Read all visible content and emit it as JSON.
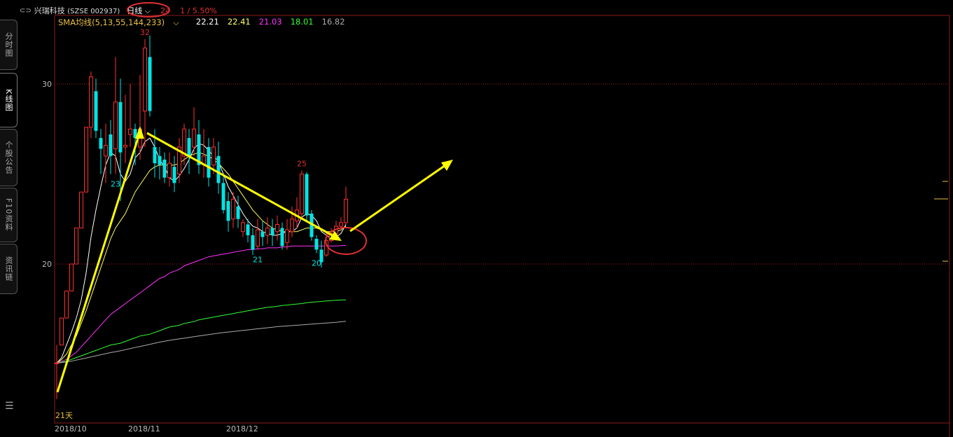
{
  "header": {
    "link_icon": "link-icon",
    "stock_name": "兴瑞科技",
    "stock_code": "(SZSE 002937)",
    "period": "日线",
    "chevron": "⌵",
    "last_label": "24",
    "page_info": "1 / 5.50%"
  },
  "sma": {
    "label": "SMA均线(5,13,55,144,233)",
    "chevron": "⌵",
    "v5": "22.21",
    "v13": "22.41",
    "v55": "21.03",
    "v144": "18.01",
    "v233": "16.82",
    "colors": {
      "v5": "#ffffff",
      "v13": "#ffff66",
      "v55": "#ff33ff",
      "v144": "#33ff33",
      "v233": "#aaaaaa"
    }
  },
  "sidebar": {
    "tabs": [
      {
        "label": "分时图"
      },
      {
        "label": "K线图"
      },
      {
        "label": "个股公告"
      },
      {
        "label": "F10资料"
      },
      {
        "label": "资讯链"
      }
    ],
    "menu_icon": "☰"
  },
  "chart_data": {
    "type": "candlestick",
    "y_ticks": [
      20,
      30
    ],
    "ylim": [
      14,
      33
    ],
    "x_labels": [
      {
        "label": "2018/10",
        "index": 0
      },
      {
        "label": "2018/11",
        "index": 15
      },
      {
        "label": "2018/12",
        "index": 35
      }
    ],
    "annotations": {
      "high": {
        "label": "32",
        "index": 18
      },
      "low1": {
        "label": "23",
        "index": 12
      },
      "high2": {
        "label": "25",
        "index": 50
      },
      "low2": {
        "label": "21",
        "index": 41
      },
      "low3": {
        "label": "20",
        "index": 53
      },
      "bottom": {
        "label": "21天"
      }
    },
    "up_color": "#ff3030",
    "down_color": "#00e5e5",
    "candles": [
      [
        14.5,
        14.5,
        15.5,
        12.5
      ],
      [
        15.5,
        17.0,
        17.0,
        15.5
      ],
      [
        17.0,
        18.5,
        18.5,
        17.0
      ],
      [
        18.5,
        20.0,
        20.0,
        18.5
      ],
      [
        20.0,
        22.0,
        22.0,
        20.0
      ],
      [
        22.0,
        24.0,
        24.0,
        22.0
      ],
      [
        24.0,
        27.6,
        27.6,
        24.0
      ],
      [
        27.6,
        30.4,
        30.7,
        27.0
      ],
      [
        29.6,
        27.4,
        30.3,
        27.0
      ],
      [
        27.0,
        26.4,
        27.5,
        25.0
      ],
      [
        26.0,
        26.6,
        27.8,
        24.5
      ],
      [
        27.2,
        26.0,
        28.0,
        25.0
      ],
      [
        26.4,
        29.0,
        31.5,
        25.0
      ],
      [
        29.0,
        26.2,
        30.3,
        23.5
      ],
      [
        26.5,
        26.6,
        29.4,
        25.6
      ],
      [
        27.2,
        27.5,
        30.0,
        26.5
      ],
      [
        27.5,
        27.0,
        27.8,
        25.5
      ],
      [
        26.5,
        27.5,
        30.5,
        25.8
      ],
      [
        28.5,
        32.0,
        32.5,
        26.5
      ],
      [
        31.5,
        28.5,
        32.7,
        28.2
      ],
      [
        26.5,
        25.6,
        27.5,
        24.8
      ],
      [
        26.0,
        25.5,
        26.5,
        24.7
      ],
      [
        25.8,
        24.8,
        26.2,
        24.5
      ],
      [
        24.8,
        25.6,
        26.2,
        24.3
      ],
      [
        25.4,
        24.5,
        26.0,
        24.0
      ],
      [
        25.0,
        26.5,
        27.0,
        24.5
      ],
      [
        26.0,
        27.5,
        27.8,
        25.5
      ],
      [
        27.0,
        26.0,
        27.5,
        25.0
      ],
      [
        26.5,
        27.5,
        28.7,
        26.0
      ],
      [
        27.2,
        25.5,
        28.0,
        25.0
      ],
      [
        25.5,
        26.0,
        27.5,
        24.8
      ],
      [
        26.5,
        24.8,
        27.0,
        24.3
      ],
      [
        25.5,
        26.5,
        27.0,
        25.0
      ],
      [
        26.0,
        24.5,
        26.8,
        23.9
      ],
      [
        24.5,
        23.0,
        25.0,
        22.8
      ],
      [
        23.5,
        22.4,
        24.0,
        21.8
      ],
      [
        22.5,
        23.6,
        24.0,
        22.0
      ],
      [
        23.2,
        22.5,
        23.8,
        22.0
      ],
      [
        21.8,
        22.3,
        22.5,
        21.5
      ],
      [
        22.2,
        21.6,
        22.5,
        21.2
      ],
      [
        21.6,
        20.8,
        22.0,
        20.5
      ],
      [
        21.0,
        21.9,
        22.5,
        20.8
      ],
      [
        21.8,
        21.5,
        22.4,
        21.0
      ],
      [
        21.6,
        22.0,
        22.6,
        21.1
      ],
      [
        22.0,
        21.6,
        22.5,
        21.0
      ],
      [
        21.8,
        22.2,
        22.7,
        21.3
      ],
      [
        22.0,
        21.0,
        22.3,
        20.8
      ],
      [
        21.2,
        21.9,
        22.5,
        20.8
      ],
      [
        21.8,
        22.5,
        23.2,
        21.5
      ],
      [
        22.4,
        23.0,
        23.7,
        22.0
      ],
      [
        22.8,
        25.0,
        25.2,
        22.5
      ],
      [
        25.0,
        22.7,
        25.1,
        22.4
      ],
      [
        22.8,
        21.5,
        23.0,
        21.3
      ],
      [
        21.4,
        20.8,
        21.6,
        20.6
      ],
      [
        20.8,
        20.1,
        21.3,
        19.8
      ],
      [
        20.5,
        21.3,
        21.8,
        20.4
      ],
      [
        21.3,
        21.7,
        22.0,
        21.2
      ],
      [
        21.7,
        22.1,
        22.4,
        21.6
      ],
      [
        22.1,
        22.3,
        22.6,
        22.0
      ],
      [
        22.3,
        23.6,
        24.3,
        22.2
      ]
    ],
    "sma_lines": [
      {
        "name": "SMA5",
        "color": "#ffffff",
        "values": [
          14.5,
          14.8,
          15.5,
          16.2,
          17.0,
          18.0,
          19.5,
          21.5,
          23.0,
          24.3,
          25.5,
          26.2,
          26.0,
          25.0,
          24.6,
          25.0,
          25.9,
          26.2,
          26.8,
          27.0,
          26.5,
          25.8,
          25.4,
          24.8,
          24.6,
          24.9,
          25.3,
          25.8,
          26.4,
          26.7,
          26.6,
          26.3,
          26.0,
          25.7,
          25.0,
          24.3,
          23.8,
          23.3,
          22.8,
          22.4,
          22.1,
          22.0,
          21.8,
          21.7,
          21.6,
          21.6,
          21.7,
          21.8,
          21.8,
          22.0,
          22.6,
          22.8,
          22.7,
          22.4,
          21.8,
          21.6,
          21.4,
          21.5,
          21.7,
          22.2
        ]
      },
      {
        "name": "SMA13",
        "color": "#ffff66",
        "values": [
          14.5,
          14.7,
          15.0,
          15.5,
          16.0,
          16.7,
          17.4,
          18.2,
          19.0,
          19.8,
          20.6,
          21.4,
          22.0,
          22.4,
          22.8,
          23.4,
          24.0,
          24.4,
          24.8,
          25.2,
          25.4,
          25.5,
          25.5,
          25.5,
          25.5,
          25.6,
          25.8,
          26.0,
          26.1,
          26.2,
          26.1,
          26.0,
          25.8,
          25.6,
          25.3,
          25.0,
          24.6,
          24.2,
          23.8,
          23.4,
          23.0,
          22.7,
          22.4,
          22.2,
          22.0,
          21.9,
          21.8,
          21.8,
          21.8,
          21.8,
          21.9,
          22.0,
          22.0,
          22.0,
          21.9,
          21.8,
          21.8,
          21.8,
          21.9,
          22.1
        ]
      },
      {
        "name": "SMA55",
        "color": "#ff33ff",
        "values": [
          14.5,
          14.6,
          14.7,
          14.9,
          15.1,
          15.4,
          15.7,
          16.0,
          16.3,
          16.6,
          16.9,
          17.2,
          17.4,
          17.6,
          17.8,
          18.0,
          18.2,
          18.4,
          18.6,
          18.8,
          19.0,
          19.2,
          19.3,
          19.5,
          19.6,
          19.7,
          19.9,
          20.0,
          20.1,
          20.2,
          20.3,
          20.4,
          20.45,
          20.5,
          20.55,
          20.6,
          20.65,
          20.7,
          20.75,
          20.8,
          20.8,
          20.85,
          20.85,
          20.9,
          20.9,
          20.9,
          20.95,
          20.95,
          21.0,
          21.0,
          21.0,
          21.0,
          21.0,
          21.0,
          21.0,
          21.0,
          21.0,
          21.0,
          21.02,
          21.03
        ]
      },
      {
        "name": "SMA144",
        "color": "#33ff33",
        "values": [
          14.5,
          14.55,
          14.6,
          14.7,
          14.8,
          14.9,
          15.0,
          15.1,
          15.2,
          15.3,
          15.4,
          15.5,
          15.55,
          15.6,
          15.7,
          15.8,
          15.9,
          16.0,
          16.05,
          16.1,
          16.2,
          16.3,
          16.4,
          16.5,
          16.55,
          16.6,
          16.7,
          16.75,
          16.8,
          16.9,
          16.95,
          17.0,
          17.05,
          17.1,
          17.15,
          17.2,
          17.25,
          17.3,
          17.35,
          17.4,
          17.45,
          17.5,
          17.55,
          17.6,
          17.62,
          17.65,
          17.7,
          17.72,
          17.75,
          17.78,
          17.8,
          17.85,
          17.88,
          17.9,
          17.92,
          17.95,
          17.97,
          17.99,
          18.0,
          18.01
        ]
      },
      {
        "name": "SMA233",
        "color": "#aaaaaa",
        "values": [
          14.5,
          14.52,
          14.56,
          14.6,
          14.66,
          14.72,
          14.78,
          14.84,
          14.9,
          14.96,
          15.02,
          15.08,
          15.13,
          15.18,
          15.24,
          15.3,
          15.36,
          15.42,
          15.48,
          15.54,
          15.6,
          15.66,
          15.71,
          15.76,
          15.8,
          15.84,
          15.88,
          15.92,
          15.96,
          16.0,
          16.04,
          16.08,
          16.12,
          16.16,
          16.19,
          16.22,
          16.25,
          16.28,
          16.31,
          16.34,
          16.37,
          16.4,
          16.43,
          16.46,
          16.49,
          16.52,
          16.54,
          16.56,
          16.58,
          16.6,
          16.62,
          16.64,
          16.66,
          16.68,
          16.7,
          16.72,
          16.74,
          16.76,
          16.79,
          16.82
        ]
      }
    ]
  }
}
